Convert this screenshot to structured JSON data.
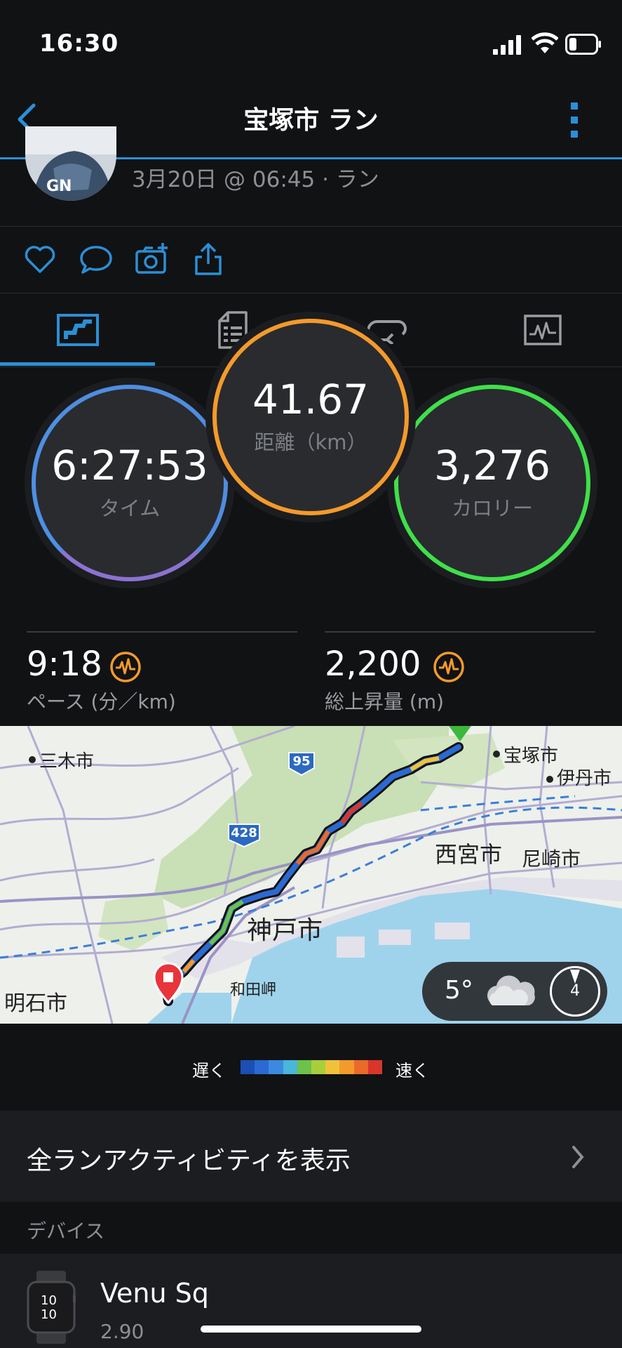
{
  "status_bar": {
    "time": "16:30"
  },
  "nav": {
    "title": "宝塚市 ラン"
  },
  "header": {
    "subtitle": "3月20日 @ 06:45 · ラン"
  },
  "social": {
    "icons": [
      "heart-icon",
      "comment-icon",
      "camera-add-icon",
      "share-icon"
    ]
  },
  "tabs": [
    {
      "icon": "map-tab-icon",
      "active": true
    },
    {
      "icon": "details-tab-icon",
      "active": false
    },
    {
      "icon": "laps-tab-icon",
      "active": false
    },
    {
      "icon": "charts-tab-icon",
      "active": false
    }
  ],
  "summary": {
    "time": {
      "value": "6:27:53",
      "label": "タイム",
      "ring_color": "#4f8de0"
    },
    "distance": {
      "value": "41.67",
      "label": "距離（km）",
      "ring_color": "#f49a2b"
    },
    "calories": {
      "value": "3,276",
      "label": "カロリー",
      "ring_color": "#3fe04a"
    }
  },
  "stats": {
    "pace": {
      "value": "9:18",
      "label": "ペース (分／km)"
    },
    "elevation": {
      "value": "2,200",
      "label": "総上昇量 (m)"
    }
  },
  "map": {
    "labels": {
      "miki": "三木市",
      "takarazuka": "宝塚市",
      "itami": "伊丹市",
      "nishinomiya": "西宮市",
      "amagasaki": "尼崎市",
      "kobe": "神戸市",
      "wadamisaki": "和田岬",
      "akashi": "明石市",
      "route_95": "95",
      "route_428": "428"
    },
    "weather": {
      "temp": "5°",
      "wind": "4"
    }
  },
  "legend": {
    "slow": "遅く",
    "fast": "速く",
    "colors": [
      "#1b4fb3",
      "#2a6ad2",
      "#3b8ae0",
      "#4ab6d8",
      "#6cc24a",
      "#a8cf3a",
      "#f0c23a",
      "#f39a2c",
      "#ea6a2a",
      "#d9362b"
    ]
  },
  "activities": {
    "label": "全ランアクティビティを表示"
  },
  "devices": {
    "section": "デバイス",
    "name": "Venu Sq",
    "version": "2.90",
    "watch_time_h": "10",
    "watch_time_m": "10"
  }
}
